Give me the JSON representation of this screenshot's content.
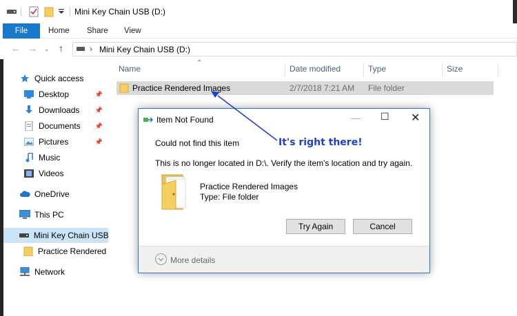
{
  "window": {
    "title": "Mini Key Chain USB (D:)"
  },
  "ribbon": {
    "tabs": [
      "File",
      "Home",
      "Share",
      "View"
    ]
  },
  "address": {
    "path": "Mini Key Chain USB (D:)"
  },
  "sidebar": {
    "items": [
      {
        "label": "Quick access",
        "icon": "star-icon"
      },
      {
        "label": "Desktop",
        "icon": "desktop-icon"
      },
      {
        "label": "Downloads",
        "icon": "download-icon"
      },
      {
        "label": "Documents",
        "icon": "documents-icon"
      },
      {
        "label": "Pictures",
        "icon": "pictures-icon"
      },
      {
        "label": "Music",
        "icon": "music-icon"
      },
      {
        "label": "Videos",
        "icon": "videos-icon"
      },
      {
        "label": "OneDrive",
        "icon": "cloud-icon"
      },
      {
        "label": "This PC",
        "icon": "computer-icon"
      },
      {
        "label": "Mini Key Chain USB (",
        "icon": "usb-drive-icon"
      },
      {
        "label": "Practice Rendered Ir",
        "icon": "folder-icon"
      },
      {
        "label": "Network",
        "icon": "network-icon"
      }
    ]
  },
  "columns": {
    "name": "Name",
    "date": "Date modified",
    "type": "Type",
    "size": "Size"
  },
  "file": {
    "name": "Practice Rendered Images",
    "date": "2/7/2018 7:21 AM",
    "type": "File folder"
  },
  "dialog": {
    "title": "Item Not Found",
    "heading": "Could not find this item",
    "message": "This is no longer located in D:\\. Verify the item's location and try again.",
    "item_name": "Practice Rendered Images",
    "item_type": "Type: File folder",
    "try_again": "Try Again",
    "cancel": "Cancel",
    "more_details": "More details"
  },
  "annotation": "It's right there!",
  "colors": {
    "accent": "#1979ca",
    "annotation": "#1f3fd0",
    "selection": "#cce4f7",
    "folder": "#f5cf62"
  }
}
